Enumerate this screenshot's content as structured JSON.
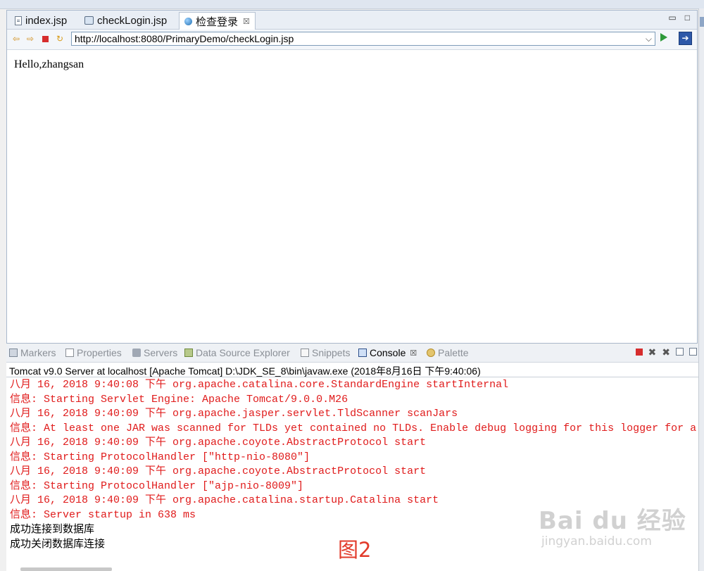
{
  "editor": {
    "tabs": [
      {
        "label": "index.jsp",
        "icon": "file-icon",
        "active": false
      },
      {
        "label": "checkLogin.jsp",
        "icon": "jsp-file-icon",
        "active": false
      },
      {
        "label": "检查登录",
        "icon": "globe-icon",
        "active": true
      }
    ],
    "window_buttons": {
      "minimize": "▭",
      "maximize": "□"
    }
  },
  "browser": {
    "url": "http://localhost:8080/PrimaryDemo/checkLogin.jsp",
    "page_text": "Hello,zhangsan"
  },
  "panel": {
    "tabs": [
      {
        "label": "Markers",
        "active": false
      },
      {
        "label": "Properties",
        "active": false
      },
      {
        "label": "Servers",
        "active": false
      },
      {
        "label": "Data Source Explorer",
        "active": false
      },
      {
        "label": "Snippets",
        "active": false
      },
      {
        "label": "Console",
        "active": true
      },
      {
        "label": "Palette",
        "active": false
      }
    ]
  },
  "console": {
    "header": "Tomcat v9.0 Server at localhost [Apache Tomcat] D:\\JDK_SE_8\\bin\\javaw.exe (2018年8月16日 下午9:40:06)",
    "lines": [
      "八月 16, 2018 9:40:08 下午 org.apache.catalina.core.StandardEngine startInternal",
      "信息: Starting Servlet Engine: Apache Tomcat/9.0.0.M26",
      "八月 16, 2018 9:40:09 下午 org.apache.jasper.servlet.TldScanner scanJars",
      "信息: At least one JAR was scanned for TLDs yet contained no TLDs. Enable debug logging for this logger for a c",
      "八月 16, 2018 9:40:09 下午 org.apache.coyote.AbstractProtocol start",
      "信息: Starting ProtocolHandler [\"http-nio-8080\"]",
      "八月 16, 2018 9:40:09 下午 org.apache.coyote.AbstractProtocol start",
      "信息: Starting ProtocolHandler [\"ajp-nio-8009\"]",
      "八月 16, 2018 9:40:09 下午 org.apache.catalina.startup.Catalina start",
      "信息: Server startup in 638 ms",
      "成功连接到数据库",
      "成功关闭数据库连接"
    ]
  },
  "figure_label": "图2",
  "watermark": {
    "main": "Bai du 经验",
    "sub": "jingyan.baidu.com"
  },
  "colors": {
    "error_text": "#e01b1b",
    "figure_label": "#e23a2a"
  }
}
